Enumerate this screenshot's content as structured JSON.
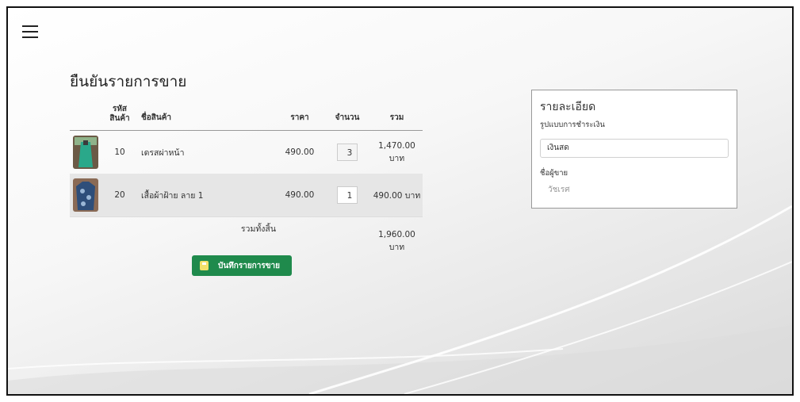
{
  "menu_icon": "hamburger-menu-icon",
  "page_title": "ยืนยันรายการขาย",
  "table": {
    "headers": {
      "code_line1": "รหัส",
      "code_line2": "สินค้า",
      "name": "ชื่อสินค้า",
      "price": "ราคา",
      "qty": "จำนวน",
      "total": "รวม"
    },
    "rows": [
      {
        "code": "10",
        "name": "เดรสผ่าหน้า",
        "price": "490.00",
        "qty": "3",
        "total_line1": "1,470.00",
        "total_line2": "บาท"
      },
      {
        "code": "20",
        "name": "เสื้อผ้าฝ้าย ลาย 1",
        "price": "490.00",
        "qty": "1",
        "total_line1": "490.00 บาท",
        "total_line2": ""
      }
    ],
    "grand_label": "รวมทั้งสิ้น",
    "grand_line1": "1,960.00",
    "grand_line2": "บาท"
  },
  "save_button": {
    "label": "บันทึกรายการขาย",
    "icon": "save-icon",
    "color": "#1f8a4c"
  },
  "details": {
    "heading": "รายละเอียด",
    "payment_label": "รูปแบบการชำระเงิน",
    "payment_value": "เงินสด",
    "seller_label": "ชื่อผู้ขาย",
    "seller_placeholder": "วัชเรศ"
  }
}
